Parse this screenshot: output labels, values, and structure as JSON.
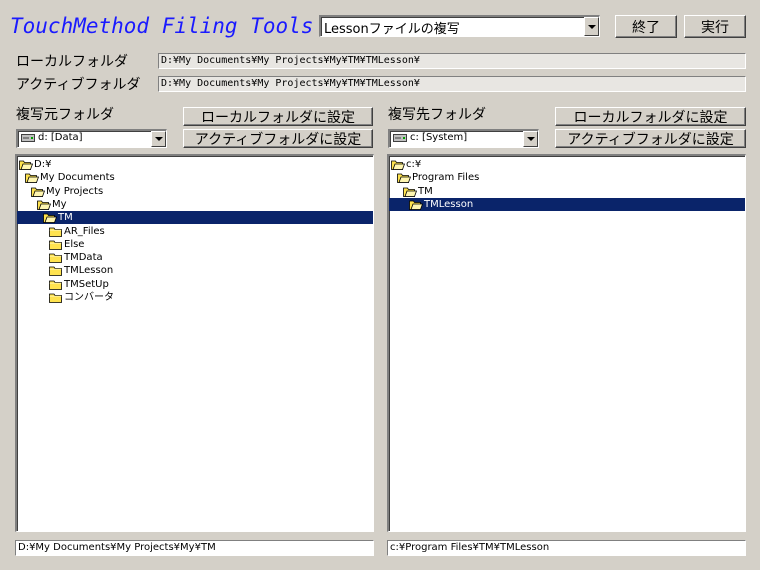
{
  "app": {
    "title": "TouchMethod Filing Tools"
  },
  "mode_select": {
    "value": "Lessonファイルの複写"
  },
  "buttons": {
    "exit": "終了",
    "run": "実行"
  },
  "local_folder": {
    "label": "ローカルフォルダ",
    "path": "D:¥My Documents¥My Projects¥My¥TM¥TMLesson¥"
  },
  "active_folder": {
    "label": "アクティブフォルダ",
    "path": "D:¥My Documents¥My Projects¥My¥TM¥TMLesson¥"
  },
  "source": {
    "label": "複写元フォルダ",
    "set_local": "ローカルフォルダに設定",
    "set_active": "アクティブフォルダに設定",
    "drive": "d: [Data]",
    "tree": [
      {
        "label": "D:¥",
        "depth": 0,
        "open": true,
        "selected": false
      },
      {
        "label": "My Documents",
        "depth": 1,
        "open": true,
        "selected": false
      },
      {
        "label": "My Projects",
        "depth": 2,
        "open": true,
        "selected": false
      },
      {
        "label": "My",
        "depth": 3,
        "open": true,
        "selected": false
      },
      {
        "label": "TM",
        "depth": 4,
        "open": true,
        "selected": true
      },
      {
        "label": "AR_Files",
        "depth": 5,
        "open": false,
        "selected": false
      },
      {
        "label": "Else",
        "depth": 5,
        "open": false,
        "selected": false
      },
      {
        "label": "TMData",
        "depth": 5,
        "open": false,
        "selected": false
      },
      {
        "label": "TMLesson",
        "depth": 5,
        "open": false,
        "selected": false
      },
      {
        "label": "TMSetUp",
        "depth": 5,
        "open": false,
        "selected": false
      },
      {
        "label": "コンバータ",
        "depth": 5,
        "open": false,
        "selected": false
      }
    ],
    "current_path": "D:¥My Documents¥My Projects¥My¥TM"
  },
  "destination": {
    "label": "複写先フォルダ",
    "set_local": "ローカルフォルダに設定",
    "set_active": "アクティブフォルダに設定",
    "drive": "c: [System]",
    "tree": [
      {
        "label": "c:¥",
        "depth": 0,
        "open": true,
        "selected": false
      },
      {
        "label": "Program Files",
        "depth": 1,
        "open": true,
        "selected": false
      },
      {
        "label": "TM",
        "depth": 2,
        "open": true,
        "selected": false
      },
      {
        "label": "TMLesson",
        "depth": 3,
        "open": true,
        "selected": true
      }
    ],
    "current_path": "c:¥Program Files¥TM¥TMLesson"
  },
  "colors": {
    "background": "#d4d0c8",
    "title": "#1a1aff",
    "selection": "#0a246a",
    "folder": "#ffe34f"
  }
}
